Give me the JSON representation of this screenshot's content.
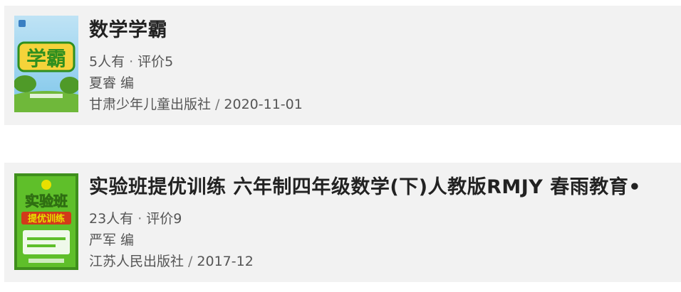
{
  "books": [
    {
      "title": "数学学霸",
      "count_text": "5人有",
      "separator": "·",
      "rating_text": "评价5",
      "author_line": "夏睿 编",
      "publisher": "甘肃少年儿童出版社",
      "slash": "/",
      "date": "2020-11-01",
      "cover": {
        "title_art": "学霸",
        "colors": {
          "sky": "#7ec6ea",
          "grass": "#6fb83a",
          "text": "#2f8f1f"
        }
      }
    },
    {
      "title": "实验班提优训练 六年制四年级数学(下)人教版RMJY 春雨教育•",
      "count_text": "23人有",
      "separator": "·",
      "rating_text": "评价9",
      "author_line": "严军 编",
      "publisher": "江苏人民出版社",
      "slash": "/",
      "date": "2017-12",
      "cover": {
        "title_art": "实验班",
        "subtitle_art": "提优训练",
        "colors": {
          "background": "#5fbf2a",
          "border": "#3f8f1c",
          "title": "#ffffff",
          "subtitle": "#e8e000"
        }
      }
    }
  ]
}
